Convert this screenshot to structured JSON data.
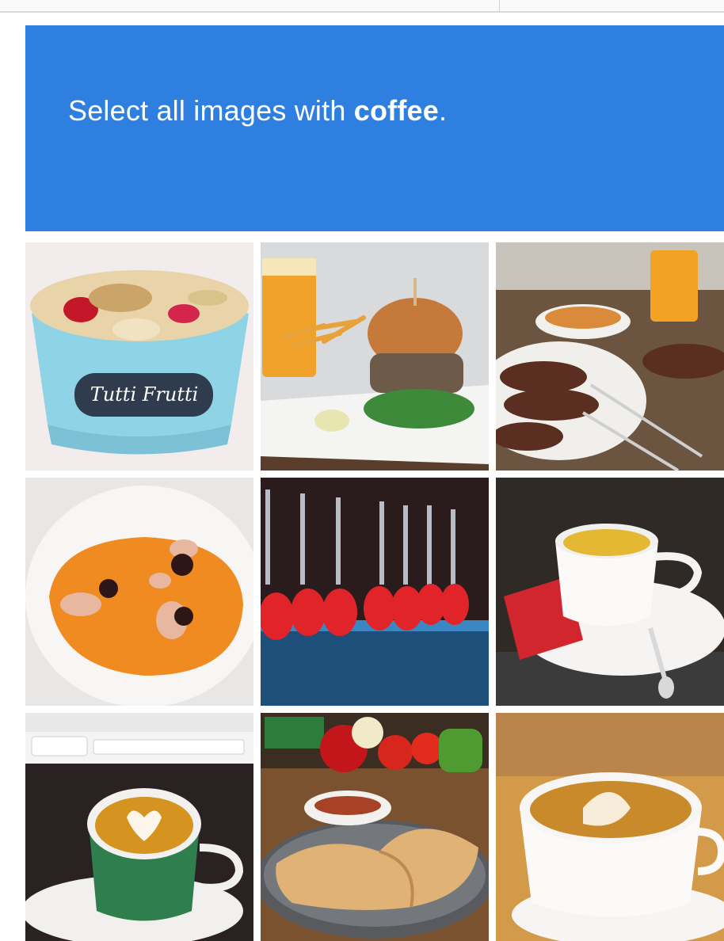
{
  "challenge": {
    "prompt_prefix": "Select all images with ",
    "prompt_keyword": "coffee",
    "prompt_suffix": "."
  },
  "tiles": [
    {
      "label": "Tutti Frutti",
      "icon": "frozen-yogurt-cup"
    },
    {
      "label": "",
      "icon": "burger-and-fries"
    },
    {
      "label": "",
      "icon": "kebab-skewers"
    },
    {
      "label": "",
      "icon": "soup-with-shrimp"
    },
    {
      "label": "",
      "icon": "hookah-pipes"
    },
    {
      "label": "",
      "icon": "espresso-cup-saucer"
    },
    {
      "label": "",
      "icon": "latte-art-green-cup"
    },
    {
      "label": "",
      "icon": "calzone-platter"
    },
    {
      "label": "",
      "icon": "latte-art-white-cup"
    }
  ],
  "colors": {
    "header_bg": "#2f7fe0",
    "header_text": "#ffffff"
  }
}
